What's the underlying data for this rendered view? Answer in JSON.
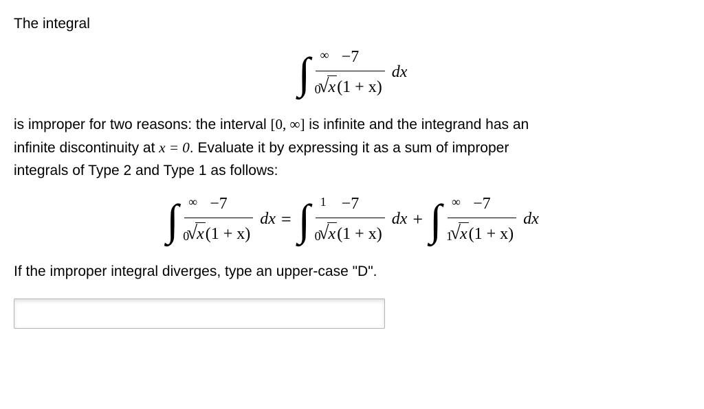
{
  "intro": "The integral",
  "main_integral": {
    "lower": "0",
    "upper": "∞",
    "numerator": "−7",
    "radicand": "x",
    "den_rest": "(1 + x)",
    "dx": "dx"
  },
  "para2_a": "is improper for two reasons: the interval ",
  "para2_interval": "[0, ∞]",
  "para2_b": " is infinite and the integrand has an",
  "para3_a": "infinite discontinuity at ",
  "para3_eq": "x = 0",
  "para3_b": ". Evaluate it by expressing it as a sum of improper",
  "para4": "integrals of Type 2 and Type 1 as follows:",
  "split": {
    "eq": "=",
    "plus": "+",
    "lhs": {
      "lower": "0",
      "upper": "∞",
      "numerator": "−7",
      "radicand": "x",
      "den_rest": "(1 + x)",
      "dx": "dx"
    },
    "r1": {
      "lower": "0",
      "upper": "1",
      "numerator": "−7",
      "radicand": "x",
      "den_rest": "(1 + x)",
      "dx": "dx"
    },
    "r2": {
      "lower": "1",
      "upper": "∞",
      "numerator": "−7",
      "radicand": "x",
      "den_rest": "(1 + x)",
      "dx": "dx"
    }
  },
  "instruction": "If the improper integral diverges, type an upper-case \"D\".",
  "answer_value": ""
}
